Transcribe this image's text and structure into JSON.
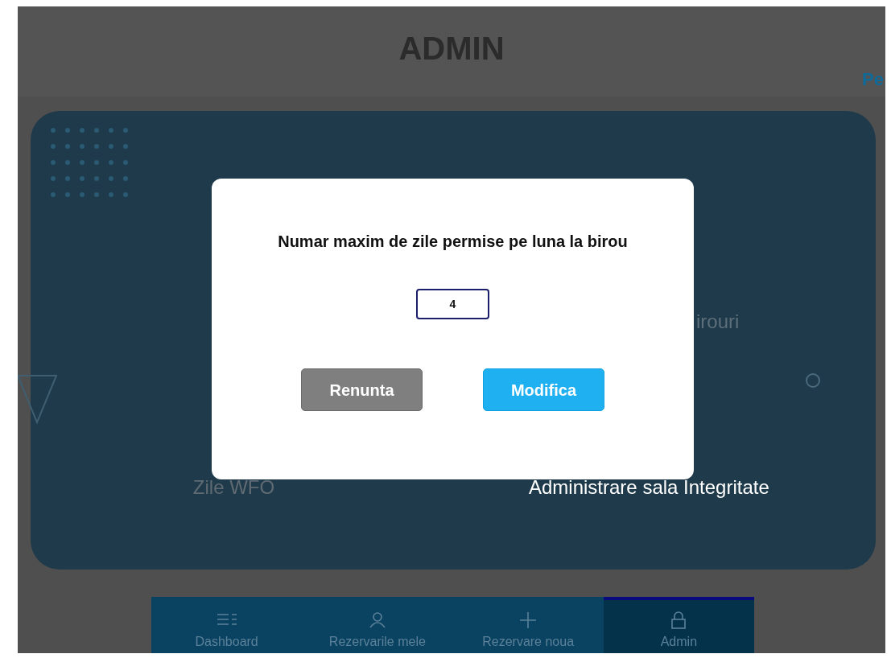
{
  "header": {
    "title": "ADMIN",
    "side_text": "Pe"
  },
  "panel": {
    "partial_label": "irouri",
    "left_label": "Zile WFO",
    "right_label": "Administrare sala Integritate"
  },
  "dialog": {
    "title": "Numar maxim de zile permise pe luna la birou",
    "value": "4",
    "buttons": [
      {
        "label": "Renunta",
        "kind": "cancel"
      },
      {
        "label": "Modifica",
        "kind": "confirm"
      }
    ]
  },
  "bottom_nav": [
    {
      "label": "Dashboard",
      "kind": "list",
      "selected": false
    },
    {
      "label": "Rezervarile mele",
      "kind": "person",
      "selected": false
    },
    {
      "label": "Rezervare noua",
      "kind": "plus",
      "selected": false
    },
    {
      "label": "Admin",
      "kind": "lock",
      "selected": true
    }
  ]
}
